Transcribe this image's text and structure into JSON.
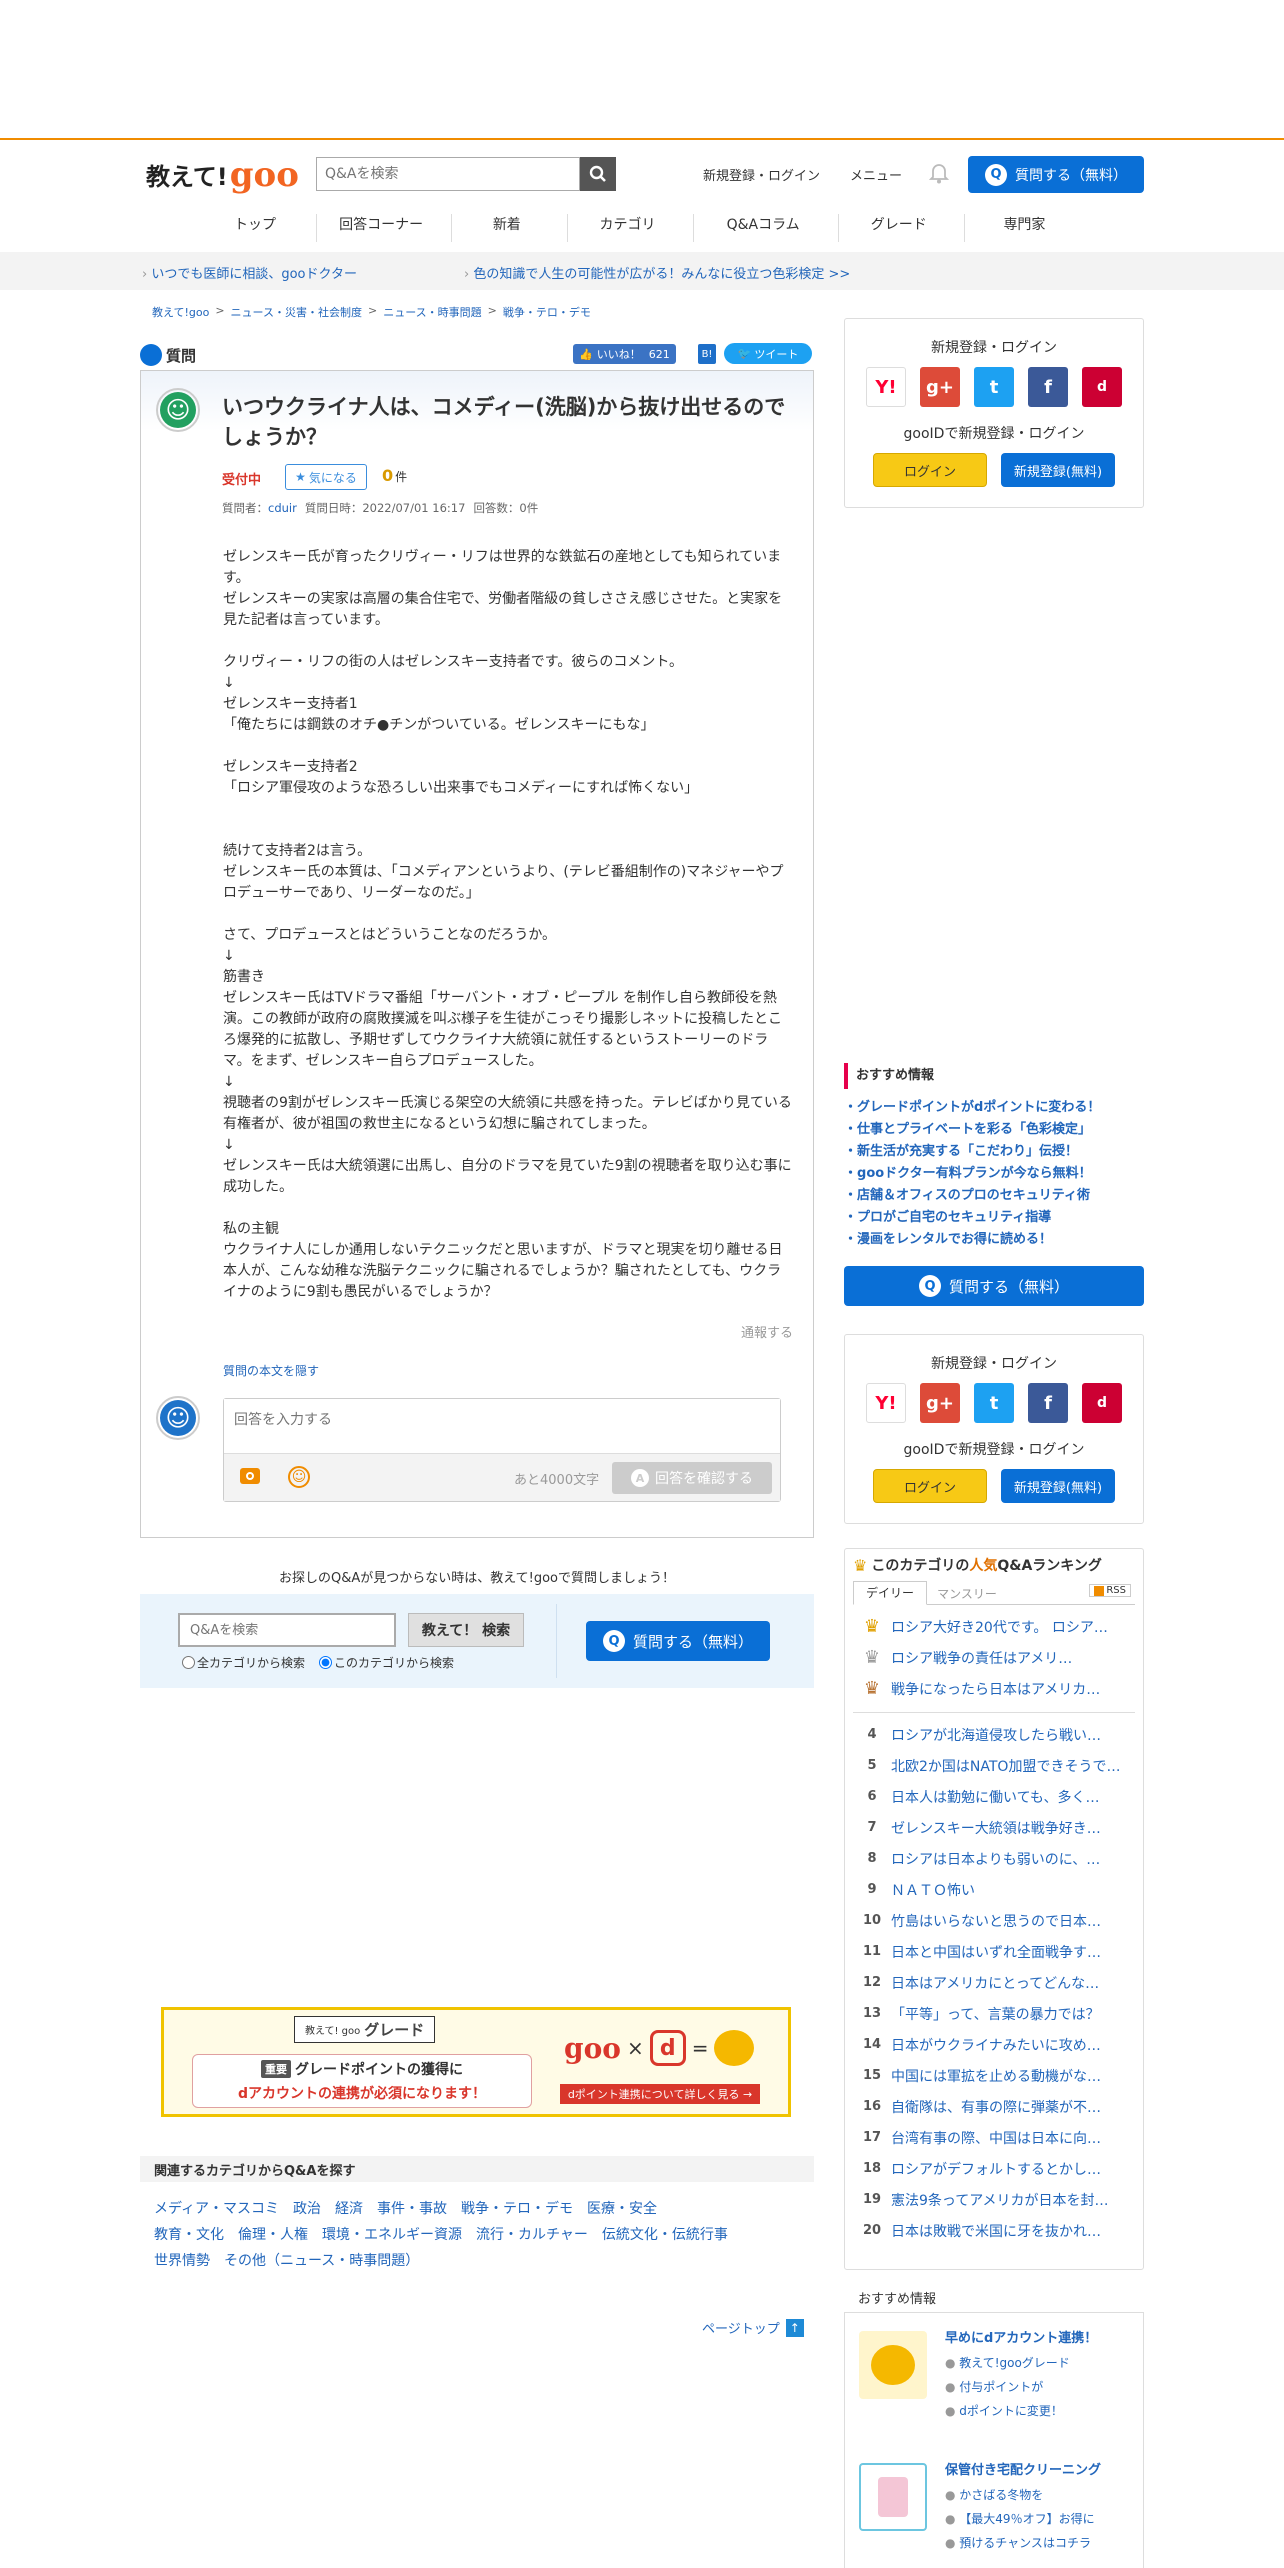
{
  "header": {
    "logo_text": "教えて!",
    "logo_goo": "goo",
    "search_placeholder": "Q&Aを検索",
    "register_login": "新規登録・ログイン",
    "menu": "メニュー",
    "ask_button": "質問する（無料）"
  },
  "nav": [
    "トップ",
    "回答コーナー",
    "新着",
    "カテゴリ",
    "Q&Aコラム",
    "グレード",
    "専門家"
  ],
  "promo": {
    "left": "いつでも医師に相談、gooドクター",
    "right": "色の知識で人生の可能性が広がる！みんなに役立つ色彩検定 >>"
  },
  "breadcrumb": [
    "教えて!goo",
    "ニュース・災害・社会制度",
    "ニュース・時事問題",
    "戦争・テロ・デモ"
  ],
  "question": {
    "section_label": "質問",
    "like_label": "いいね！",
    "like_count": "621",
    "tweet_label": "ツイート",
    "title": "いつウクライナ人は、コメディー(洗脳)から抜け出せるのでしょうか？",
    "status": "受付中",
    "follow_label": "気になる",
    "follow_count": "0",
    "follow_unit": "件",
    "meta_author_label": "質問者：",
    "meta_author": "cduir",
    "meta_date": "質問日時：2022/07/01 16:17",
    "meta_answers": "回答数：0件",
    "body": [
      "ゼレンスキー氏が育ったクリヴィー・リフは世界的な鉄鉱石の産地としても知られています。",
      "ゼレンスキーの実家は高層の集合住宅で、労働者階級の貧しささえ感じさせた。と実家を見た記者は言っています。",
      "",
      "クリヴィー・リフの街の人はゼレンスキー支持者です。彼らのコメント。",
      "↓",
      "ゼレンスキー支持者1",
      "「俺たちには鋼鉄のオチ●チンがついている。ゼレンスキーにもな」",
      "",
      "ゼレンスキー支持者2",
      "「ロシア軍侵攻のような恐ろしい出来事でもコメディーにすれば怖くない」",
      "",
      "",
      "続けて支持者2は言う。",
      "ゼレンスキー氏の本質は、「コメディアンというより、(テレビ番組制作の)マネジャーやプロデューサーであり、リーダーなのだ。」",
      "",
      "さて、プロデュースとはどういうことなのだろうか。",
      "↓",
      "筋書き",
      "ゼレンスキー氏はTVドラマ番組「サーバント・オブ・ピープル を制作し自ら教師役を熱演。この教師が政府の腐敗撲滅を叫ぶ様子を生徒がこっそり撮影しネットに投稿したところ爆発的に拡散し、予期せずしてウクライナ大統領に就任するというストーリーのドラマ。をまず、ゼレンスキー自らプロデュースした。",
      "↓",
      "視聴者の9割がゼレンスキー氏演じる架空の大統領に共感を持った。テレビばかり見ている有権者が、彼が祖国の救世主になるという幻想に騙されてしまった。",
      "↓",
      "ゼレンスキー氏は大統領選に出馬し、自分のドラマを見ていた9割の視聴者を取り込む事に成功した。",
      "",
      "私の主観",
      "ウクライナ人にしか通用しないテクニックだと思いますが、ドラマと現実を切り離せる日本人が、こんな幼稚な洗脳テクニックに騙されるでしょうか？騙されたとしても、ウクライナのように9割も愚民がいるでしょうか？"
    ],
    "report": "通報する",
    "hide_body": "質問の本文を隠す",
    "answer_placeholder": "回答を入力する",
    "remaining": "あと4000文字",
    "confirm_button": "回答を確認する"
  },
  "not_found": {
    "text": "お探しのQ&Aが見つからない時は、教えて!gooで質問しましょう！",
    "search_placeholder": "Q&Aを検索",
    "search_button": "教えて！ 検索",
    "ask_button": "質問する（無料）",
    "radio_all": "全カテゴリから検索",
    "radio_this": "このカテゴリから検索"
  },
  "grade_banner": {
    "tag": "教えて! goo",
    "title": "グレード",
    "line1": "グレードポイントの獲得に",
    "badge": "重要",
    "line2": "dアカウントの連携が必須になります！",
    "goo": "goo",
    "times": "×",
    "dpoint": "d",
    "eq": "=",
    "link": "dポイント連携について詳しく見る →"
  },
  "related": {
    "title": "関連するカテゴリからQ&Aを探す",
    "items": [
      "メディア・マスコミ",
      "政治",
      "経済",
      "事件・事故",
      "戦争・テロ・デモ",
      "医療・安全",
      "教育・文化",
      "倫理・人権",
      "環境・エネルギー資源",
      "流行・カルチャー",
      "伝統文化・伝統行事",
      "世界情勢",
      "その他（ニュース・時事問題）"
    ]
  },
  "page_top": "ページトップ",
  "sidebar": {
    "login_title": "新規登録・ログイン",
    "gooid_text": "gooIDで新規登録・ログイン",
    "login_button": "ログイン",
    "register_button": "新規登録(無料)",
    "sns": [
      "Y!",
      "g+",
      "t",
      "f",
      "d"
    ],
    "recommend_title": "おすすめ情報",
    "recommend": [
      "グレードポイントがdポイントに変わる！",
      "仕事とプライベートを彩る「色彩検定」",
      "新生活が充実する「こだわり」伝授！",
      "gooドクター有料プランが今なら無料！",
      "店舗＆オフィスのプロのセキュリティ術",
      "プロがご自宅のセキュリティ指導",
      "漫画をレンタルでお得に読める！"
    ],
    "ask_button": "質問する（無料）",
    "ranking_title_pre": "このカテゴリの",
    "ranking_title_hl": "人気",
    "ranking_title_post": "Q&Aランキング",
    "tab_daily": "デイリー",
    "tab_monthly": "マンスリー",
    "rss": "RSS",
    "ranking": [
      "ロシア大好き20代です。 ロシア…",
      "ロシア戦争の責任はアメリ…",
      "戦争になったら日本はアメリカ…",
      "ロシアが北海道侵攻したら戦い…",
      "北欧2か国はNATO加盟できそうで…",
      "日本人は勤勉に働いても、多く…",
      "ゼレンスキー大統領は戦争好き…",
      "ロシアは日本よりも弱いのに、…",
      "ＮＡＴＯ怖い",
      "竹島はいらないと思うので日本…",
      "日本と中国はいずれ全面戦争す…",
      "日本はアメリカにとってどんな…",
      "「平等」って、言葉の暴力では？",
      "日本がウクライナみたいに攻め…",
      "中国には軍拡を止める動機がな…",
      "自衛隊は、有事の際に弾薬が不…",
      "台湾有事の際、中国は日本に向…",
      "ロシアがデフォルトするとかし…",
      "憲法9条ってアメリカが日本を封…",
      "日本は敗戦で米国に牙を抜かれ…"
    ],
    "ranking_nums": [
      "1",
      "2",
      "3",
      "4",
      "5",
      "6",
      "7",
      "8",
      "9",
      "10",
      "11",
      "12",
      "13",
      "14",
      "15",
      "16",
      "17",
      "18",
      "19",
      "20"
    ],
    "recommend2_title": "おすすめ情報",
    "promo1_title": "早めにdアカウント連携！",
    "promo1_lines": [
      "教えて!gooグレード",
      "付与ポイントが",
      "dポイントに変更！"
    ],
    "promo2_title": "保管付き宅配クリーニング",
    "promo2_lines": [
      "かさばる冬物を",
      "【最大49％オフ】お得に",
      "預けるチャンスはコチラ"
    ]
  },
  "colors": {
    "accent_orange": "#f08c00",
    "brand_blue": "#0a6fd6",
    "link_blue": "#2266bb",
    "goo_orange": "#f26522"
  }
}
